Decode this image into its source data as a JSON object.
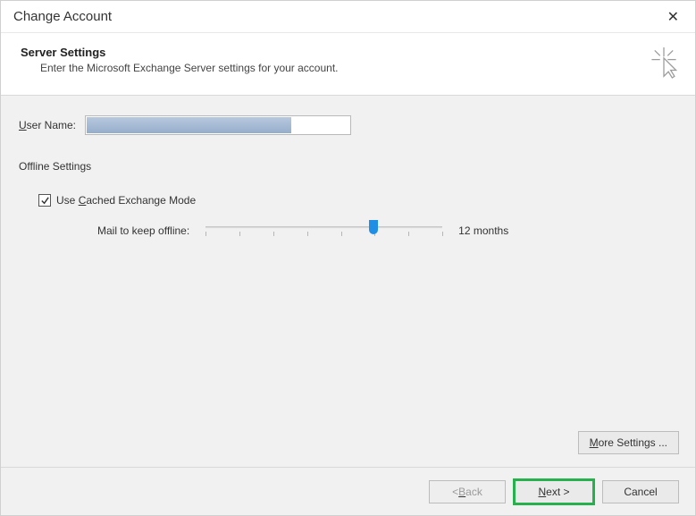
{
  "window": {
    "title": "Change Account"
  },
  "header": {
    "heading": "Server Settings",
    "subtext": "Enter the Microsoft Exchange Server settings for your account."
  },
  "form": {
    "user_label_u": "U",
    "user_label_rest": "ser Name:",
    "offline_section": "Offline Settings",
    "cache_label_pre": "Use ",
    "cache_label_u": "C",
    "cache_label_post": "ached Exchange Mode",
    "cache_checked": true,
    "slider_label": "Mail to keep offline:",
    "slider_value_text": "12 months",
    "slider_ticks": 8,
    "slider_position_pct": 71
  },
  "buttons": {
    "more_u": "M",
    "more_rest": "ore Settings ...",
    "back_pre": "< ",
    "back_u": "B",
    "back_post": "ack",
    "next_u": "N",
    "next_post": "ext >",
    "cancel": "Cancel"
  }
}
